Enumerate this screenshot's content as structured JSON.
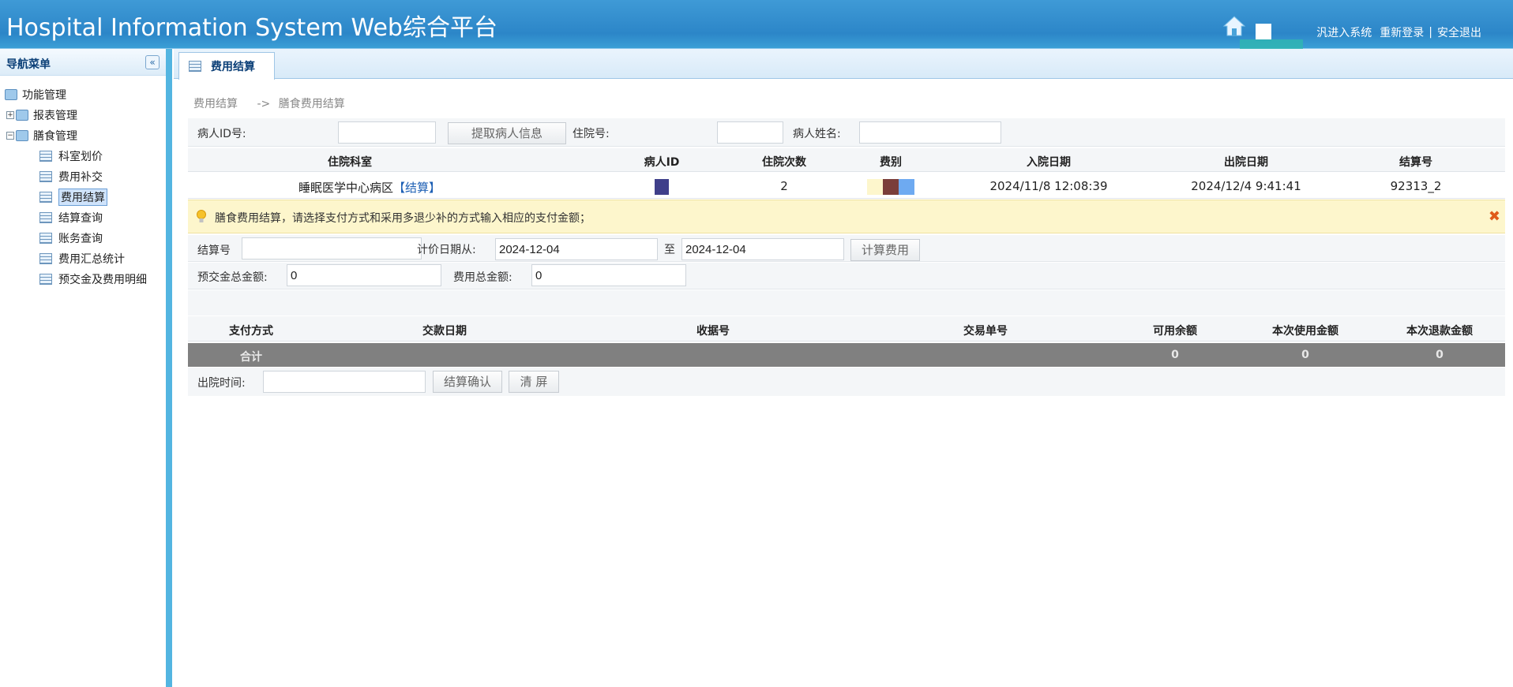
{
  "header": {
    "title": "Hospital Information System Web综合平台",
    "toolbar": {
      "enter_text": "汎进入系统",
      "relogin": "重新登录",
      "separator": "|",
      "logout": "安全退出"
    },
    "home_icon": "home-icon"
  },
  "sidebar": {
    "title": "导航菜单",
    "collapse_symbol": "«",
    "root": "功能管理",
    "groups": [
      {
        "label": "报表管理",
        "expanded": false
      },
      {
        "label": "膳食管理",
        "expanded": true
      }
    ],
    "items": [
      {
        "label": "科室划价",
        "selected": false
      },
      {
        "label": "费用补交",
        "selected": false
      },
      {
        "label": "费用结算",
        "selected": true
      },
      {
        "label": "结算查询",
        "selected": false
      },
      {
        "label": "账务查询",
        "selected": false
      },
      {
        "label": "费用汇总统计",
        "selected": false
      },
      {
        "label": "预交金及费用明细",
        "selected": false
      }
    ]
  },
  "tab": {
    "label": "费用结算"
  },
  "breadcrumb": {
    "part1": "费用结算",
    "arrow": "->",
    "part2": "膳食费用结算"
  },
  "patient_search": {
    "patient_id_label": "病人ID号:",
    "patient_id_value": "",
    "fetch_button": "提取病人信息",
    "inpatient_no_label": "住院号:",
    "inpatient_no_value": "",
    "patient_name_label": "病人姓名:",
    "patient_name_value": ""
  },
  "patient_table": {
    "columns": [
      "住院科室",
      "病人ID",
      "住院次数",
      "费别",
      "入院日期",
      "出院日期",
      "结算号"
    ],
    "row": {
      "department": "睡眠医学中心病区",
      "settle_link": "【结算】",
      "patient_id": "",
      "visits": "2",
      "fee_type": "",
      "admit_date": "2024/11/8 12:08:39",
      "discharge_date": "2024/12/4 9:41:41",
      "settle_no": "92313_2"
    }
  },
  "alert": {
    "message": "膳食费用结算，请选择支付方式和采用多退少补的方式输入相应的支付金额；",
    "close_symbol": "✖"
  },
  "calc": {
    "settle_no_label": "结算号",
    "settle_no_value": "",
    "date_from_label": "计价日期从:",
    "date_from": "2024-12-04",
    "to_label": "至",
    "date_to": "2024-12-04",
    "calc_button": "计算费用"
  },
  "amounts": {
    "prepay_label": "预交金总金额:",
    "prepay_value": "0",
    "fee_label": "费用总金额:",
    "fee_value": "0"
  },
  "payment_table": {
    "columns": [
      "支付方式",
      "交款日期",
      "收据号",
      "交易单号",
      "可用余额",
      "本次使用金额",
      "本次退款金额"
    ],
    "total": {
      "label": "合计",
      "available": "0",
      "used": "0",
      "refund": "0"
    }
  },
  "discharge": {
    "label": "出院时间:",
    "value": "",
    "confirm_button": "结算确认",
    "clear_button": "清 屏"
  },
  "colors": {
    "header_bg": "#2c86c8",
    "sidebar_border": "#53b5e1",
    "alert_bg": "#fdf6cc",
    "total_row_bg": "#808080",
    "link": "#1c5fb4",
    "close": "#e05b1a"
  }
}
